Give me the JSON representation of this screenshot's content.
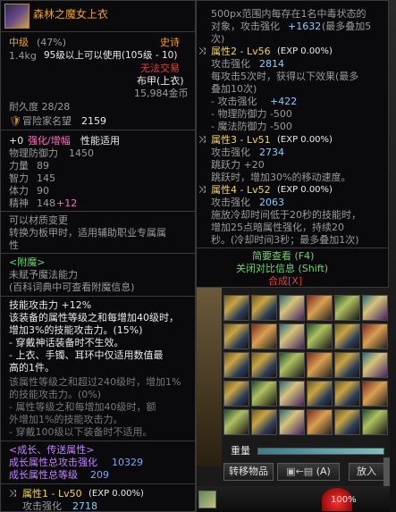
{
  "left": {
    "item_name": "森林之魔女上衣",
    "level_label": "中级",
    "level_pct": "(47%)",
    "rarity": "史诗",
    "weight": "1.4kg",
    "use_req": "95级以上可以使用(105级 - 10)",
    "trade": "无法交易",
    "type": "布甲(上衣)",
    "price": "15,984金币",
    "durability": "耐久度 28/28",
    "adventure": "冒险家名望",
    "adventure_val": "2159",
    "enhance_prefix": "+0",
    "enhance_label": "强化/增幅",
    "enhance_suffix": "性能适用",
    "stats": [
      {
        "label": "物理防御力",
        "value": "1450"
      },
      {
        "label": "力量",
        "value": "89"
      },
      {
        "label": "智力",
        "value": "145"
      },
      {
        "label": "体力",
        "value": "90"
      },
      {
        "label": "精神",
        "value": "148",
        "bonus": "+12"
      }
    ],
    "transfer": "可以材质变更",
    "transfer_desc1": "转换为板甲时，适用辅助职业专属属",
    "transfer_desc2": "性",
    "enchant_header": "<附魔>",
    "enchant_none": "未赋予魔法能力",
    "enchant_hint": "(百科词典中可查看附魔信息)",
    "skill_title": "技能攻击力 +12%",
    "skill_lines": [
      "该装备的属性等级之和每增加40级时，",
      "增加3%的技能攻击力。(15%)",
      "- 穿戴神话装备时不生效。"
    ],
    "set_lines": [
      "- 上衣、手镯、耳环中仅适用数值最",
      "高的1件。"
    ],
    "dim_lines": [
      "该属性等级之和超过240级时，增加1%",
      "的技能攻击力。(0%)",
      "- 属性等级之和每增加40级时，额",
      "外增加1%的技能攻击力。",
      "- 穿戴100级以下装备时不适用。"
    ],
    "growth_header": "<成长、传送属性>",
    "growth1": "成长属性总攻击强化",
    "growth1_val": "10329",
    "growth2": "成长属性总等级",
    "growth2_val": "209",
    "attr1": "属性1 - Lv50",
    "attr1_exp": "(EXP 0.00%)",
    "attr1_atk": "攻击强化",
    "attr1_atk_val": "2718"
  },
  "right": {
    "lines_top": [
      "500px范围内每存在1名中毒状态的",
      "对象，攻击强化"
    ],
    "top_atk": "+1632",
    "top_max": "(最多叠加5",
    "top_cont": "次)",
    "attr2": "属性2 - Lv56",
    "attr2_exp": "(EXP 0.00%)",
    "attr2_atk": "攻击强化",
    "attr2_atk_val": "2814",
    "attr2_desc": [
      "每攻击5次时，获得以下效果(最多",
      "叠加10次)"
    ],
    "attr2_eff1": "- 攻击强化",
    "attr2_eff1_val": "+422",
    "attr2_eff2": "- 物理防御力 -500",
    "attr2_eff3": "- 魔法防御力 -500",
    "attr3": "属性3 - Lv51",
    "attr3_exp": "(EXP 0.00%)",
    "attr3_atk": "攻击强化",
    "attr3_atk_val": "2734",
    "attr3_desc": [
      "跳跃力 +20",
      "跳跃时，增加30%的移动速度。"
    ],
    "attr4": "属性4 - Lv52",
    "attr4_exp": "(EXP 0.00%)",
    "attr4_atk": "攻击强化",
    "attr4_atk_val": "2063",
    "attr4_desc": [
      "施放冷却时间低于20秒的技能时，",
      "增加25点暗属性强化，持续20",
      "秒。(冷却时间3秒；最多叠加1次)"
    ],
    "link1": "简要查看 (F4)",
    "link2": "关闭对比信息 (Shift)",
    "link3": "合成[X]"
  },
  "inventory": {
    "weight_label": "重量",
    "transfer_btn": "转移物品",
    "move_btn": "(A)",
    "put_btn": "放入",
    "pct": "100%"
  },
  "colors": {
    "accent_gold": "#e8c060",
    "epic_orange": "#f0a020",
    "bonus_blue": "#7aa7ff"
  }
}
